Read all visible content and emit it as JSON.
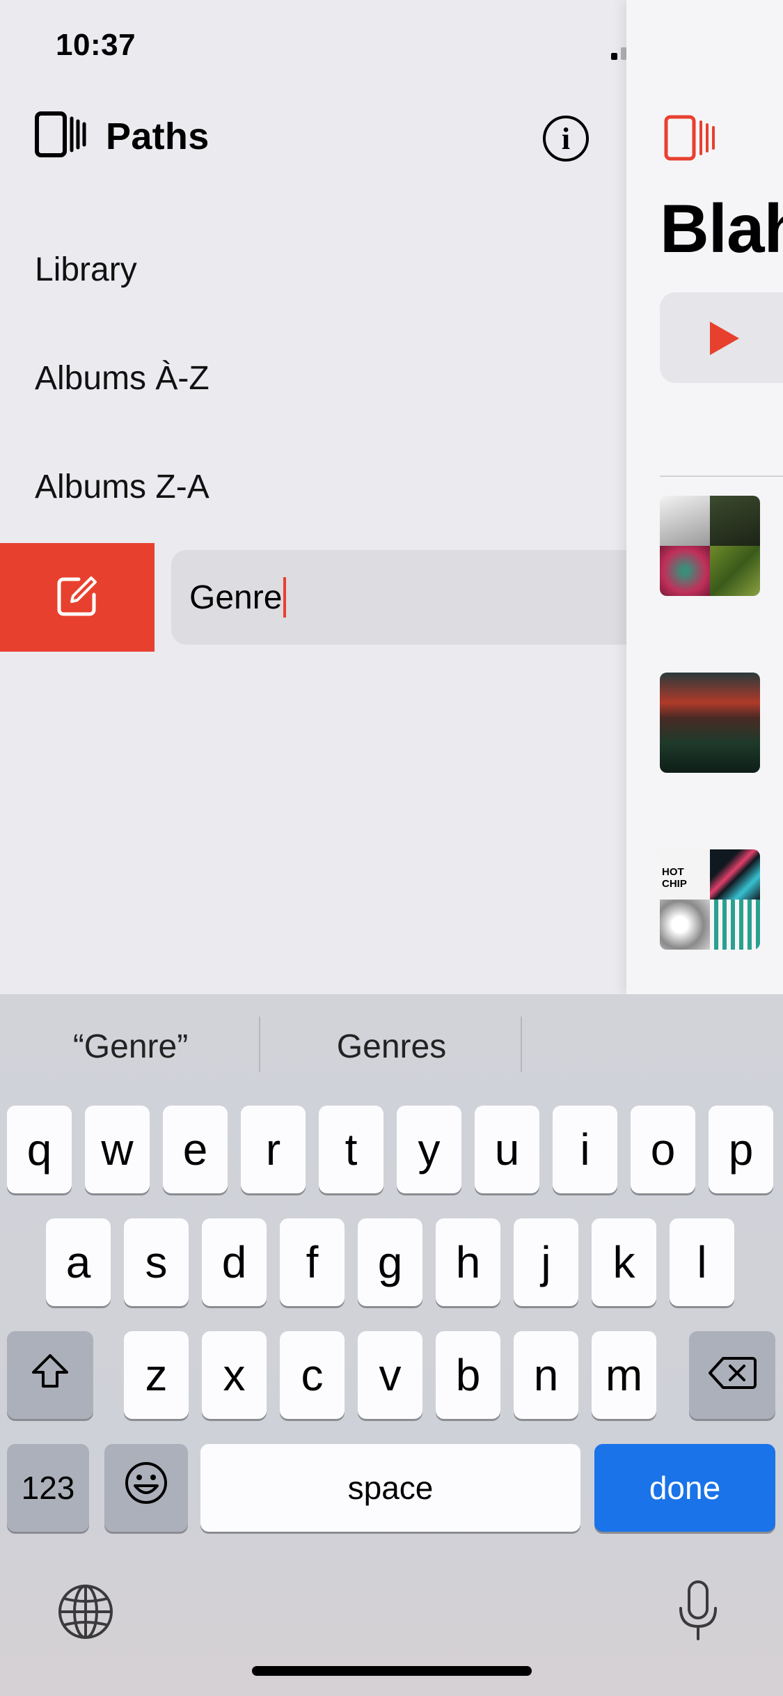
{
  "status_bar": {
    "time": "10:37"
  },
  "sidebar": {
    "title": "Paths",
    "items": [
      "Library",
      "Albums À-Z",
      "Albums Z-A"
    ],
    "editing": {
      "value": "Genre"
    }
  },
  "detail": {
    "title": "Blah"
  },
  "keyboard": {
    "suggestions": [
      "“Genre”",
      "Genres",
      ""
    ],
    "row1": [
      "q",
      "w",
      "e",
      "r",
      "t",
      "y",
      "u",
      "i",
      "o",
      "p"
    ],
    "row2": [
      "a",
      "s",
      "d",
      "f",
      "g",
      "h",
      "j",
      "k",
      "l"
    ],
    "row3": [
      "z",
      "x",
      "c",
      "v",
      "b",
      "n",
      "m"
    ],
    "numbers_label": "123",
    "space_label": "space",
    "done_label": "done"
  },
  "colors": {
    "accent": "#E8402E",
    "done": "#1A73E8",
    "sidebar_bg": "#EAEAEF"
  }
}
